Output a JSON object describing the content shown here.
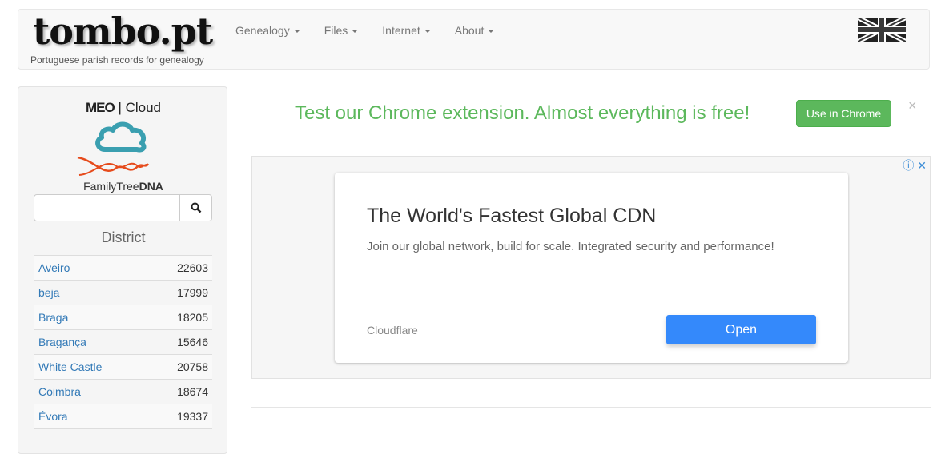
{
  "brand": {
    "logo": "tombo.pt",
    "tagline": "Portuguese parish records for genealogy"
  },
  "nav": {
    "items": [
      {
        "label": "Genealogy"
      },
      {
        "label": "Files"
      },
      {
        "label": "Internet"
      },
      {
        "label": "About"
      }
    ]
  },
  "language": {
    "icon": "uk-flag-icon"
  },
  "sidebar": {
    "meo_logo": "MEO",
    "meo_suffix": "| Cloud",
    "ftdna_prefix": "FamilyTree",
    "ftdna_suffix": "DNA",
    "search": {
      "value": "",
      "placeholder": ""
    },
    "district_heading": "District",
    "districts": [
      {
        "name": "Aveiro",
        "count": "22603"
      },
      {
        "name": "beja",
        "count": "17999"
      },
      {
        "name": "Braga",
        "count": "18205"
      },
      {
        "name": "Bragança",
        "count": "15646"
      },
      {
        "name": "White Castle",
        "count": "20758"
      },
      {
        "name": "Coimbra",
        "count": "18674"
      },
      {
        "name": "Évora",
        "count": "19337"
      },
      {
        "name": "",
        "count": ""
      }
    ]
  },
  "promo": {
    "text": "Test our Chrome extension. Almost everything is free!",
    "button": "Use in Chrome",
    "close": "×"
  },
  "ad": {
    "title": "The World's Fastest Global CDN",
    "subtitle": "Join our global network, build for scale. Integrated security and performance!",
    "brand": "Cloudflare",
    "button": "Open",
    "info_icon": "ⓘ",
    "close_icon": "✕"
  }
}
